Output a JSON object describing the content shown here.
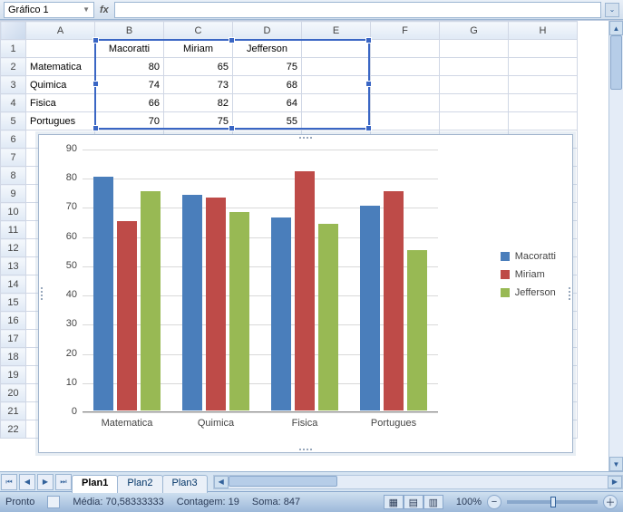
{
  "formula_bar": {
    "name_box": "Gráfico 1",
    "fx_symbol": "fx"
  },
  "columns": [
    "A",
    "B",
    "C",
    "D",
    "E",
    "F",
    "G",
    "H"
  ],
  "rows": [
    "1",
    "2",
    "3",
    "4",
    "5",
    "6",
    "7",
    "8",
    "9",
    "10",
    "11",
    "12",
    "13",
    "14",
    "15",
    "16",
    "17",
    "18",
    "19",
    "20",
    "21",
    "22"
  ],
  "data": {
    "headers": [
      "Macoratti",
      "Miriam",
      "Jefferson"
    ],
    "subjects": [
      "Matematica",
      "Quimica",
      "Fisica",
      "Portugues"
    ],
    "values": [
      [
        80,
        65,
        75
      ],
      [
        74,
        73,
        68
      ],
      [
        66,
        82,
        64
      ],
      [
        70,
        75,
        55
      ]
    ]
  },
  "chart_data": {
    "type": "bar",
    "categories": [
      "Matematica",
      "Quimica",
      "Fisica",
      "Portugues"
    ],
    "series": [
      {
        "name": "Macoratti",
        "values": [
          80,
          74,
          66,
          70
        ],
        "color": "#4a7ebb"
      },
      {
        "name": "Miriam",
        "values": [
          65,
          73,
          82,
          75
        ],
        "color": "#be4b48"
      },
      {
        "name": "Jefferson",
        "values": [
          75,
          68,
          64,
          55
        ],
        "color": "#98b954"
      }
    ],
    "ylim": [
      0,
      90
    ],
    "yticks": [
      0,
      10,
      20,
      30,
      40,
      50,
      60,
      70,
      80,
      90
    ]
  },
  "tabs": {
    "active": "Plan1",
    "items": [
      "Plan1",
      "Plan2",
      "Plan3"
    ]
  },
  "status": {
    "ready": "Pronto",
    "avg_label": "Média:",
    "avg_value": "70,58333333",
    "count_label": "Contagem:",
    "count_value": "19",
    "sum_label": "Soma:",
    "sum_value": "847",
    "zoom": "100%"
  }
}
